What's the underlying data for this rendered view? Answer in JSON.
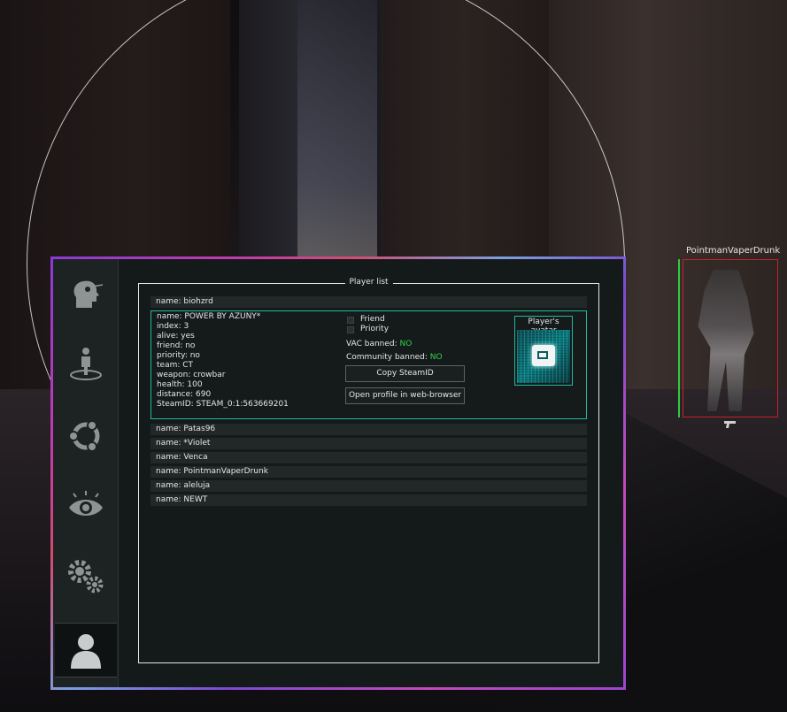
{
  "esp": {
    "player_name": "PointmanVaperDrunk",
    "weapon_icon": "pistol-icon"
  },
  "menu": {
    "sidebar": [
      {
        "id": "aimbot",
        "icon": "aim-head-icon",
        "active": false
      },
      {
        "id": "triggerbot",
        "icon": "standing-figure-icon",
        "active": false
      },
      {
        "id": "misc",
        "icon": "ubuntu-circle-icon",
        "active": false
      },
      {
        "id": "visuals",
        "icon": "eye-icon",
        "active": false
      },
      {
        "id": "settings",
        "icon": "gears-icon",
        "active": false
      },
      {
        "id": "player-list",
        "icon": "user-icon",
        "active": true
      }
    ],
    "player_list": {
      "title": "Player list",
      "rows_above": [
        {
          "label": "name: biohzrd"
        }
      ],
      "selected": {
        "lines": [
          "name: POWER BY AZUNY*",
          "index: 3",
          "alive: yes",
          "friend: no",
          "priority: no",
          "team: CT",
          "weapon: crowbar",
          "health: 100",
          "distance: 690",
          "SteamID: STEAM_0:1:563669201"
        ],
        "friend_label": "Friend",
        "friend_checked": false,
        "priority_label": "Priority",
        "priority_checked": false,
        "vac_label": "VAC banned: ",
        "vac_value": "NO",
        "community_label": "Community banned: ",
        "community_value": "NO",
        "copy_button": "Copy SteamID",
        "open_button": "Open profile in web-browser",
        "avatar_title": "Player's avatar",
        "status_color": "#2fd34a"
      },
      "rows_below": [
        {
          "label": "name: Patas96"
        },
        {
          "label": "name: *Violet"
        },
        {
          "label": "name: Venca"
        },
        {
          "label": "name: PointmanVaperDrunk"
        },
        {
          "label": "name: aleluja"
        },
        {
          "label": "name: NEWT"
        }
      ]
    }
  },
  "colors": {
    "accent_teal": "#22b89a",
    "esp_box": "#c8202a",
    "health_bar": "#2ecc40"
  }
}
